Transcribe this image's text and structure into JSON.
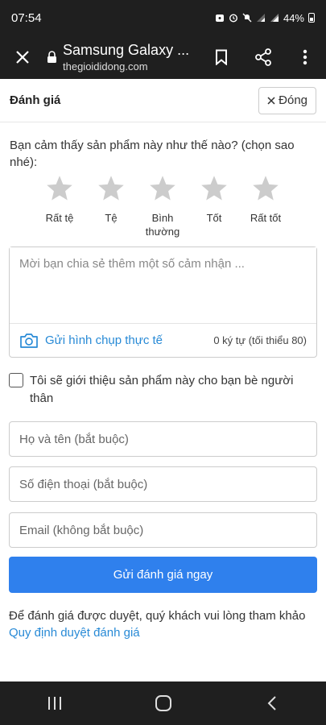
{
  "status_bar": {
    "time": "07:54",
    "battery": "44%"
  },
  "browser": {
    "title": "Samsung Galaxy ...",
    "url": "thegioididong.com"
  },
  "header": {
    "title": "Đánh giá",
    "close_label": "Đóng"
  },
  "rating": {
    "question": "Bạn cảm thấy sản phẩm này như thế nào? (chọn sao nhé):",
    "stars": [
      {
        "label": "Rất tệ"
      },
      {
        "label": "Tệ"
      },
      {
        "label": "Bình thường"
      },
      {
        "label": "Tốt"
      },
      {
        "label": "Rất tốt"
      }
    ],
    "selected": 0,
    "star_color": "#cccccc"
  },
  "review": {
    "placeholder": "Mời bạn chia sẻ thêm một số cảm nhận ...",
    "photo_label": "Gửi hình chụp thực tế",
    "char_count": "0 ký tự (tối thiểu 80)"
  },
  "refer": {
    "label": "Tôi sẽ giới thiệu sản phẩm này cho bạn bè người thân",
    "checked": false
  },
  "form": {
    "name_placeholder": "Họ và tên (bắt buộc)",
    "phone_placeholder": "Số điện thoại (bắt buộc)",
    "email_placeholder": "Email (không bắt buộc)",
    "submit_label": "Gửi đánh giá ngay"
  },
  "note": {
    "text": "Để đánh giá được duyệt, quý khách vui lòng tham khảo",
    "link": "Quy định duyệt đánh giá"
  },
  "colors": {
    "accent": "#2f80ed",
    "link": "#288ad6",
    "chrome": "#1f1f1f"
  }
}
